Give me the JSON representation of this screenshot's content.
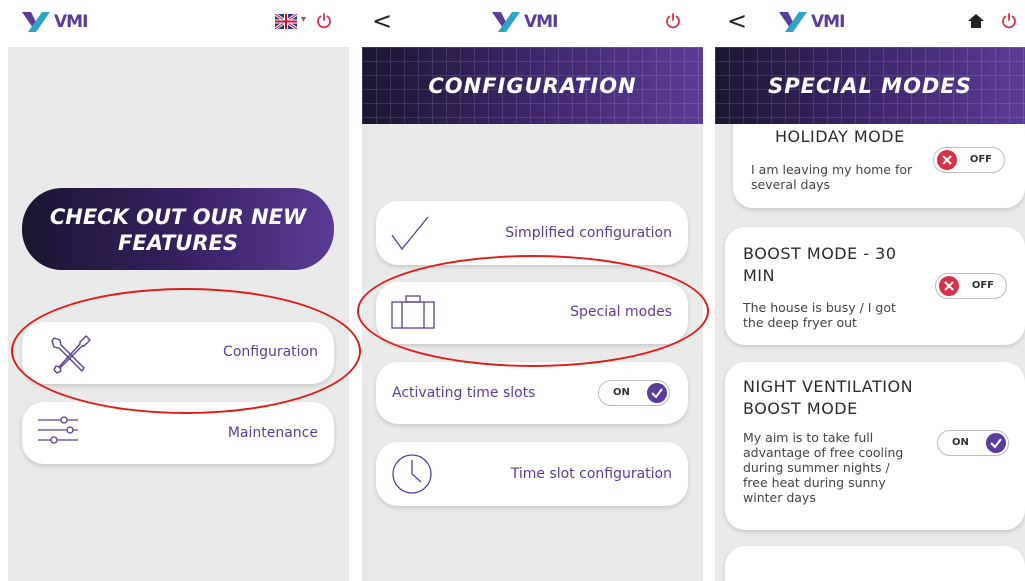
{
  "colors": {
    "accent": "#5a3d9a",
    "power": "#d8314b",
    "annotation": "#e21a1a",
    "off_knob": "#d8314b"
  },
  "brand": {
    "word": "VMI"
  },
  "icons": {
    "power": "power-icon",
    "back": "back-chevron-icon",
    "home": "home-icon",
    "flag": "uk-flag-icon",
    "tools": "tools-icon",
    "sliders": "sliders-icon",
    "checkmark": "checkmark-icon",
    "suitcase": "suitcase-icon",
    "clock": "clock-icon"
  },
  "screen1": {
    "language_flag": "UK",
    "promo": {
      "line1": "CHECK OUT OUR NEW",
      "line2": "FEATURES"
    },
    "menu": [
      {
        "label": "Configuration",
        "icon": "tools-icon"
      },
      {
        "label": "Maintenance",
        "icon": "sliders-icon"
      }
    ]
  },
  "screen2": {
    "back": "<",
    "title": "CONFIGURATION",
    "items": [
      {
        "label": "Simplified configuration"
      },
      {
        "label": "Special modes"
      },
      {
        "label": "Activating time slots",
        "toggle": "ON"
      },
      {
        "label": "Time slot configuration"
      }
    ]
  },
  "screen3": {
    "back": "<",
    "title": "SPECIAL MODES",
    "modes": [
      {
        "title": "HOLIDAY MODE",
        "desc": [
          "I am leaving my home for",
          "several days"
        ],
        "toggle": "OFF"
      },
      {
        "title": [
          "BOOST MODE - 30",
          "MIN"
        ],
        "desc": [
          "The house is busy / I got",
          "the deep fryer out"
        ],
        "toggle": "OFF"
      },
      {
        "title": [
          "NIGHT VENTILATION",
          "BOOST MODE"
        ],
        "desc": [
          "My aim is to take full",
          "advantage of free cooling",
          "during summer nights /",
          "free heat during sunny",
          "winter days"
        ],
        "toggle": "ON"
      }
    ]
  }
}
